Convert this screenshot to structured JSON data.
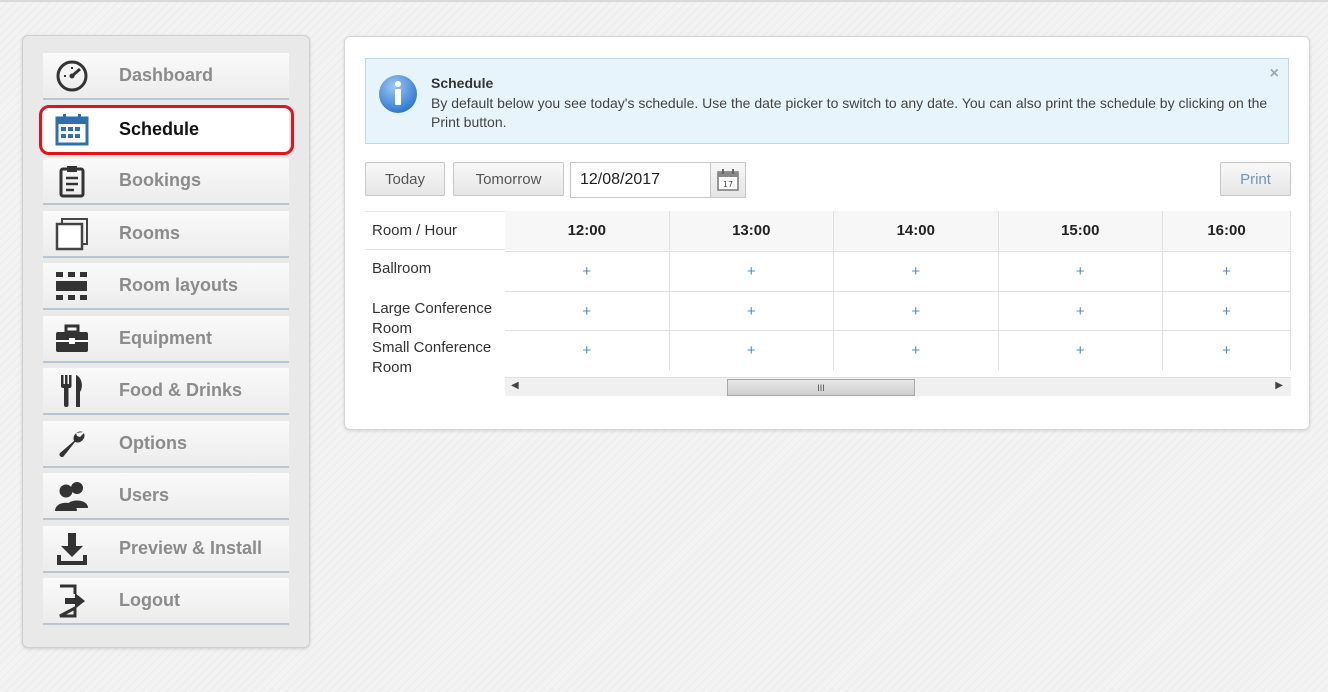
{
  "sidebar": {
    "items": [
      {
        "label": "Dashboard",
        "icon": "gauge-icon",
        "active": false
      },
      {
        "label": "Schedule",
        "icon": "calendar-icon",
        "active": true
      },
      {
        "label": "Bookings",
        "icon": "clipboard-icon",
        "active": false
      },
      {
        "label": "Rooms",
        "icon": "rooms-icon",
        "active": false
      },
      {
        "label": "Room layouts",
        "icon": "layout-icon",
        "active": false
      },
      {
        "label": "Equipment",
        "icon": "toolbox-icon",
        "active": false
      },
      {
        "label": "Food & Drinks",
        "icon": "fork-knife-icon",
        "active": false
      },
      {
        "label": "Options",
        "icon": "wrench-icon",
        "active": false
      },
      {
        "label": "Users",
        "icon": "users-icon",
        "active": false
      },
      {
        "label": "Preview & Install",
        "icon": "download-icon",
        "active": false
      },
      {
        "label": "Logout",
        "icon": "logout-icon",
        "active": false
      }
    ]
  },
  "info": {
    "title": "Schedule",
    "text": "By default below you see today's schedule. Use the date picker to switch to any date. You can also print the schedule by clicking on the Print button.",
    "close": "×"
  },
  "controls": {
    "today": "Today",
    "tomorrow": "Tomorrow",
    "date": "12/08/2017",
    "calendar_day": "17",
    "print": "Print"
  },
  "schedule": {
    "corner": "Room / Hour",
    "hours": [
      "12:00",
      "13:00",
      "14:00",
      "15:00",
      "16:00"
    ],
    "rooms": [
      "Ballroom",
      "Large Conference Room",
      "Small Conference Room"
    ],
    "add_symbol": "+"
  },
  "scrollbar": {
    "left": "◀",
    "right": "▶",
    "grip": "III"
  },
  "colors": {
    "highlight": "#e3121b",
    "accent": "#4a90c8",
    "info_bg": "#e8f4fb"
  }
}
